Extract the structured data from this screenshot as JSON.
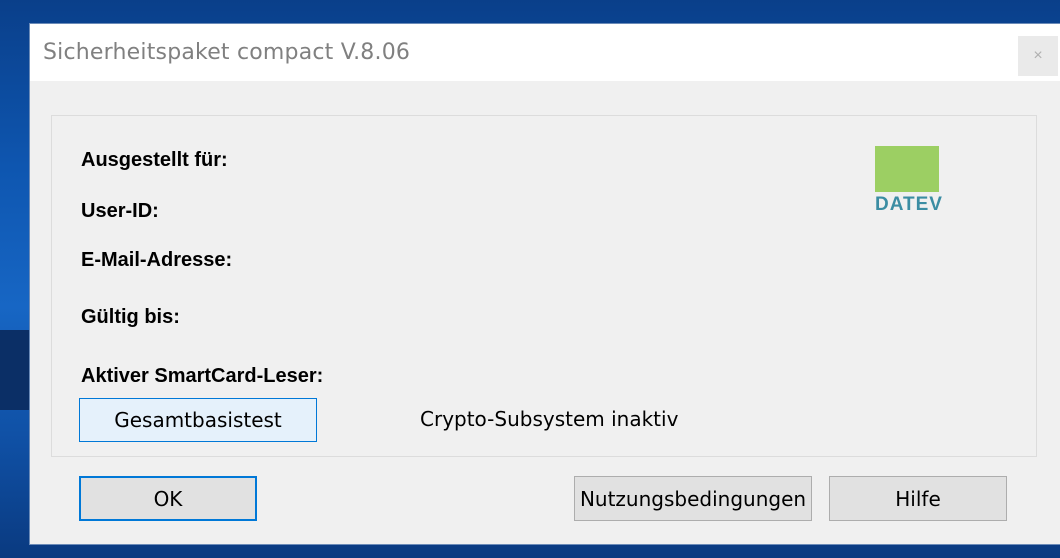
{
  "window": {
    "title": "Sicherheitspaket compact V.8.06",
    "close_glyph": "×"
  },
  "labels": {
    "issued_for": "Ausgestellt für:",
    "user_id": "User-ID:",
    "email": "E-Mail-Adresse:",
    "valid_until": "Gültig bis:",
    "active_reader": "Aktiver SmartCard-Leser:"
  },
  "logo": {
    "text": "DATEV",
    "square_color": "#9ccf63",
    "text_color": "#3b8da3"
  },
  "buttons": {
    "basistest": "Gesamtbasistest",
    "ok": "OK",
    "terms": "Nutzungsbedingungen",
    "help": "Hilfe"
  },
  "status": {
    "crypto": "Crypto-Subsystem inaktiv"
  },
  "colors": {
    "focus_border": "#0078d7",
    "window_bg": "#f0f0f0"
  }
}
